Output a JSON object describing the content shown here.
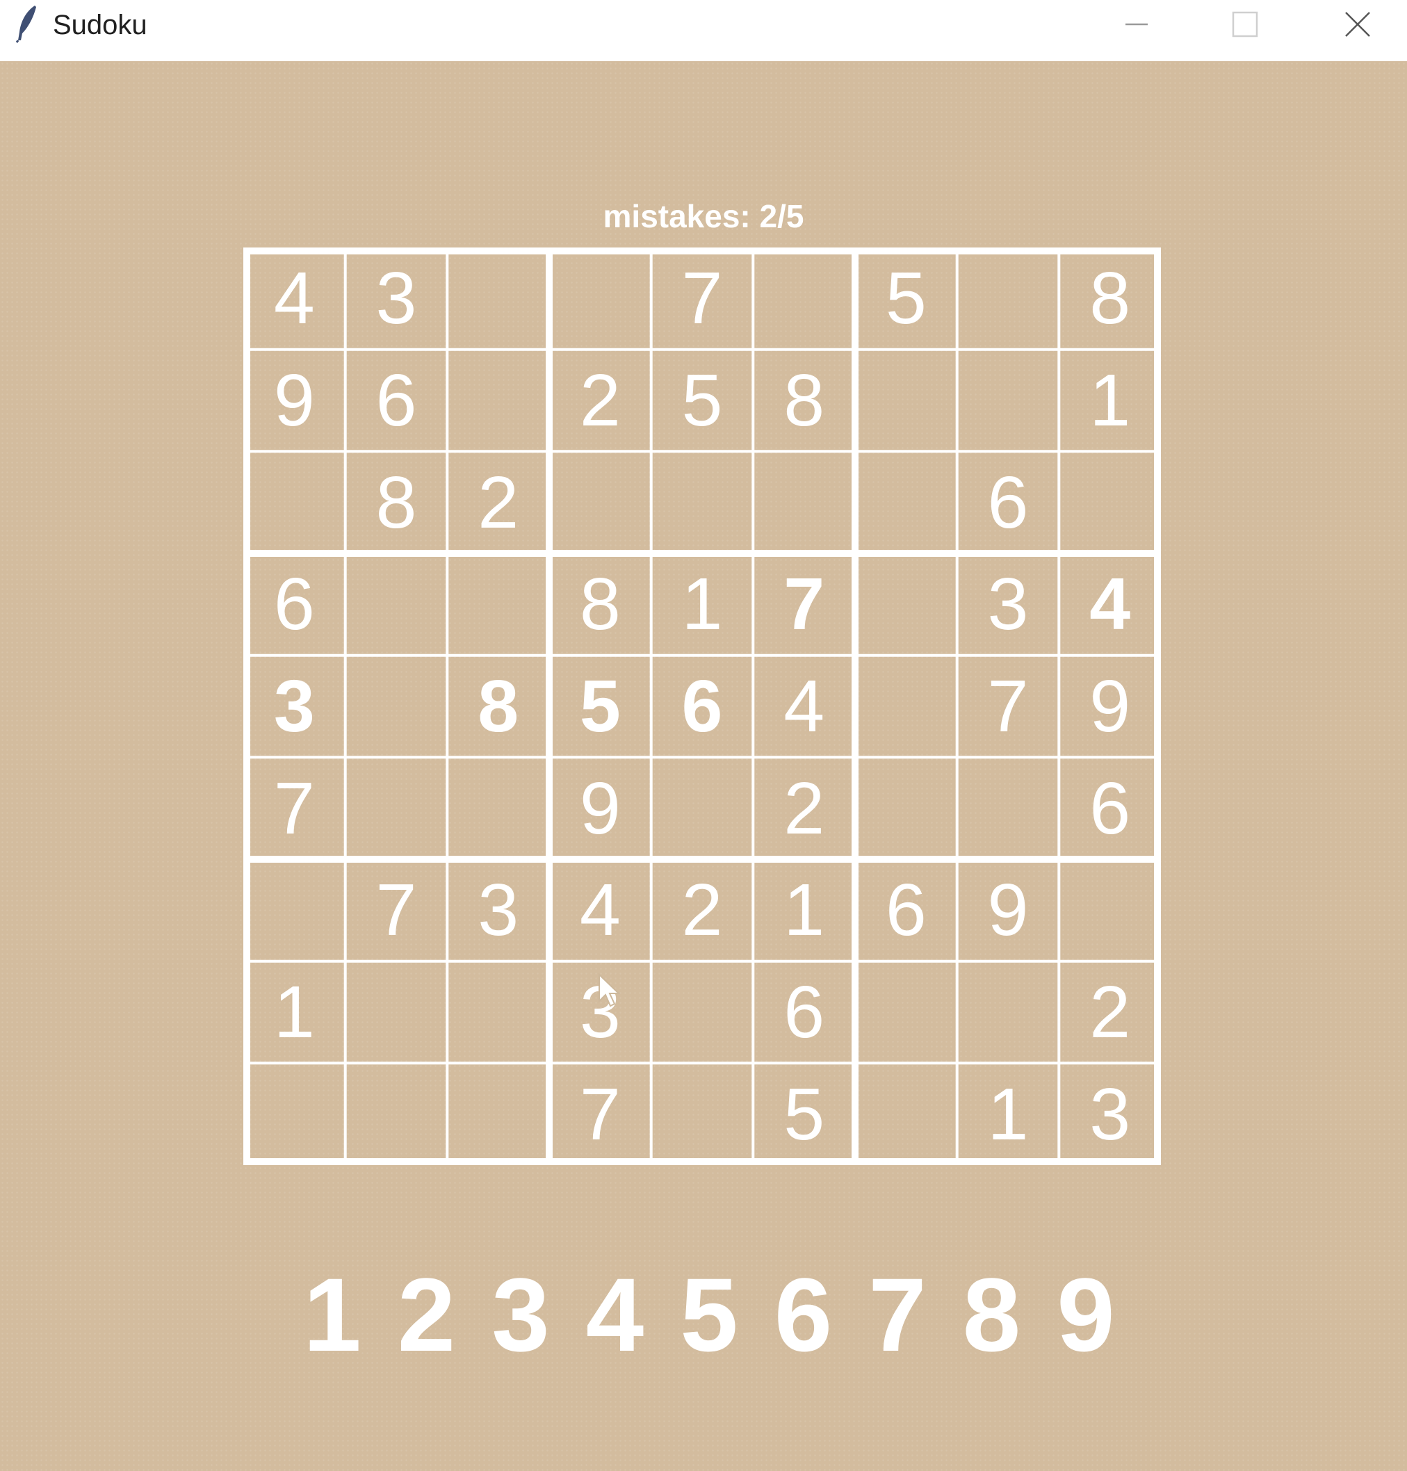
{
  "window": {
    "title": "Sudoku",
    "icon": "feather-icon",
    "controls": [
      "minimize-icon",
      "maximize-icon",
      "close-icon"
    ]
  },
  "status": {
    "mistakes_label": "mistakes: 2/5"
  },
  "colors": {
    "background": "#d3bc9e",
    "grid_and_text": "#ffffff",
    "titlebar": "#ffffff"
  },
  "board": {
    "rows": [
      [
        "4",
        "3",
        "",
        "",
        "7",
        "",
        "5",
        "",
        "8"
      ],
      [
        "9",
        "6",
        "",
        "2",
        "5",
        "8",
        "",
        "",
        "1"
      ],
      [
        "",
        "8",
        "2",
        "",
        "",
        "",
        "",
        "6",
        ""
      ],
      [
        "6",
        "",
        "",
        "8",
        "1",
        "7",
        "",
        "3",
        "4"
      ],
      [
        "3",
        "",
        "8",
        "5",
        "6",
        "4",
        "",
        "7",
        "9"
      ],
      [
        "7",
        "",
        "",
        "9",
        "",
        "2",
        "",
        "",
        "6"
      ],
      [
        "",
        "7",
        "3",
        "4",
        "2",
        "1",
        "6",
        "9",
        ""
      ],
      [
        "1",
        "",
        "",
        "3",
        "",
        "6",
        "",
        "",
        "2"
      ],
      [
        "",
        "",
        "",
        "7",
        "",
        "5",
        "",
        "1",
        "3"
      ]
    ],
    "bold": [
      [
        false,
        false,
        false,
        false,
        false,
        false,
        false,
        false,
        false
      ],
      [
        false,
        false,
        false,
        false,
        false,
        false,
        false,
        false,
        false
      ],
      [
        false,
        false,
        false,
        false,
        false,
        false,
        false,
        false,
        false
      ],
      [
        false,
        false,
        false,
        false,
        false,
        true,
        false,
        false,
        true
      ],
      [
        true,
        false,
        true,
        true,
        true,
        false,
        false,
        false,
        false
      ],
      [
        false,
        false,
        false,
        false,
        false,
        false,
        false,
        false,
        false
      ],
      [
        false,
        false,
        false,
        false,
        false,
        false,
        false,
        false,
        false
      ],
      [
        false,
        false,
        false,
        false,
        false,
        false,
        false,
        false,
        false
      ],
      [
        false,
        false,
        false,
        false,
        false,
        false,
        false,
        false,
        false
      ]
    ]
  },
  "number_picker": [
    "1",
    "2",
    "3",
    "4",
    "5",
    "6",
    "7",
    "8",
    "9"
  ]
}
